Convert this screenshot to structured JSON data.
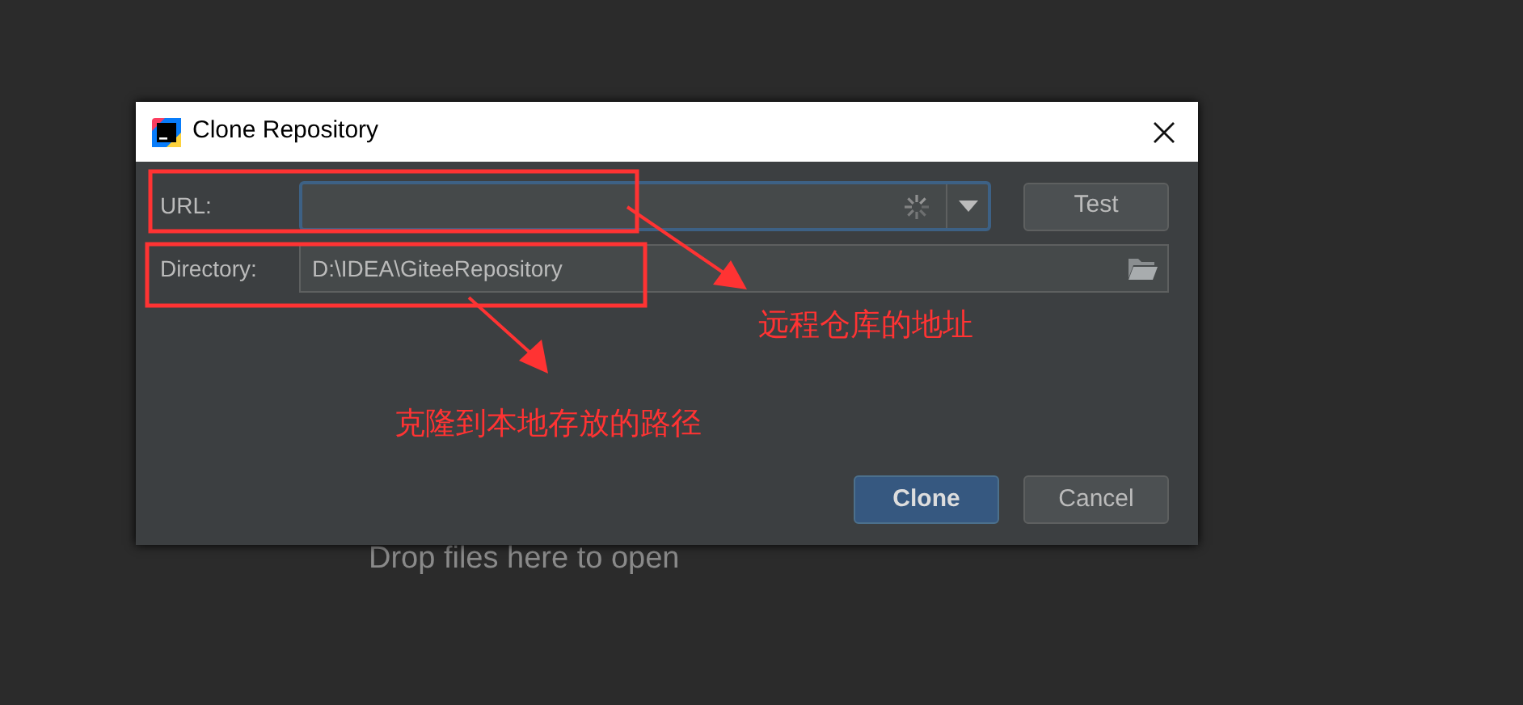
{
  "background_hint": "Drop files here to open",
  "dialog": {
    "title": "Clone Repository",
    "url": {
      "label": "URL:",
      "focused": true
    },
    "test_button": "Test",
    "directory": {
      "label": "Directory:",
      "value": "D:\\IDEA\\GiteeRepository"
    },
    "buttons": [
      {
        "label": "Clone",
        "kind": "primary"
      },
      {
        "label": "Cancel",
        "kind": "default"
      }
    ]
  },
  "annotations": [
    {
      "text": "远程仓库的地址"
    },
    {
      "text": "克隆到本地存放的路径"
    }
  ]
}
